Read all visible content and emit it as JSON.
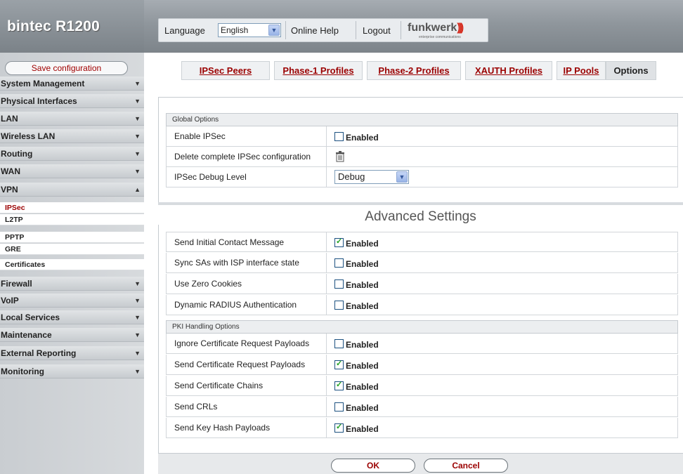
{
  "app": {
    "title": "bintec R1200"
  },
  "topbar": {
    "language_label": "Language",
    "language_value": "English",
    "online_help": "Online Help",
    "logout": "Logout",
    "logo_text": "funkwerk",
    "logo_subtext": "enterprise communications"
  },
  "sidebar": {
    "save_label": "Save configuration",
    "items": [
      {
        "label": "System Management",
        "state": "collapsed"
      },
      {
        "label": "Physical Interfaces",
        "state": "collapsed"
      },
      {
        "label": "LAN",
        "state": "collapsed"
      },
      {
        "label": "Wireless LAN",
        "state": "collapsed"
      },
      {
        "label": "Routing",
        "state": "collapsed"
      },
      {
        "label": "WAN",
        "state": "collapsed"
      },
      {
        "label": "VPN",
        "state": "expanded"
      },
      {
        "label": "Firewall",
        "state": "collapsed"
      },
      {
        "label": "VoIP",
        "state": "collapsed"
      },
      {
        "label": "Local Services",
        "state": "collapsed"
      },
      {
        "label": "Maintenance",
        "state": "collapsed"
      },
      {
        "label": "External Reporting",
        "state": "collapsed"
      },
      {
        "label": "Monitoring",
        "state": "collapsed"
      }
    ],
    "vpn_sub": [
      "IPSec",
      "L2TP",
      "PPTP",
      "GRE",
      "Certificates"
    ],
    "active_sub": "IPSec"
  },
  "tabs": [
    {
      "label": "IPSec Peers",
      "selected": false
    },
    {
      "label": "Phase-1 Profiles",
      "selected": false
    },
    {
      "label": "Phase-2 Profiles",
      "selected": false
    },
    {
      "label": "XAUTH Profiles",
      "selected": false
    },
    {
      "label": "IP Pools",
      "selected": false
    },
    {
      "label": "Options",
      "selected": true
    }
  ],
  "global_options": {
    "heading": "Global Options",
    "enable_ipsec": {
      "label": "Enable IPSec",
      "checked": false,
      "value_label": "Enabled"
    },
    "delete_config": {
      "label": "Delete complete IPSec configuration",
      "icon": "trash-icon"
    },
    "debug_level": {
      "label": "IPSec Debug Level",
      "value": "Debug"
    }
  },
  "advanced": {
    "title": "Advanced Settings",
    "rows": [
      {
        "label": "Send Initial Contact Message",
        "checked": true,
        "value_label": "Enabled"
      },
      {
        "label": "Sync SAs with ISP interface state",
        "checked": false,
        "value_label": "Enabled"
      },
      {
        "label": "Use Zero Cookies",
        "checked": false,
        "value_label": "Enabled"
      },
      {
        "label": "Dynamic RADIUS Authentication",
        "checked": false,
        "value_label": "Enabled"
      }
    ],
    "pki_heading": "PKI Handling Options",
    "pki_rows": [
      {
        "label": "Ignore Certificate Request Payloads",
        "checked": false,
        "value_label": "Enabled"
      },
      {
        "label": "Send Certificate Request Payloads",
        "checked": true,
        "value_label": "Enabled"
      },
      {
        "label": "Send Certificate Chains",
        "checked": true,
        "value_label": "Enabled"
      },
      {
        "label": "Send CRLs",
        "checked": false,
        "value_label": "Enabled"
      },
      {
        "label": "Send Key Hash Payloads",
        "checked": true,
        "value_label": "Enabled"
      }
    ]
  },
  "footer": {
    "ok": "OK",
    "cancel": "Cancel"
  },
  "colors": {
    "accent_red": "#9b0000",
    "checkmark_green": "#21a121"
  }
}
